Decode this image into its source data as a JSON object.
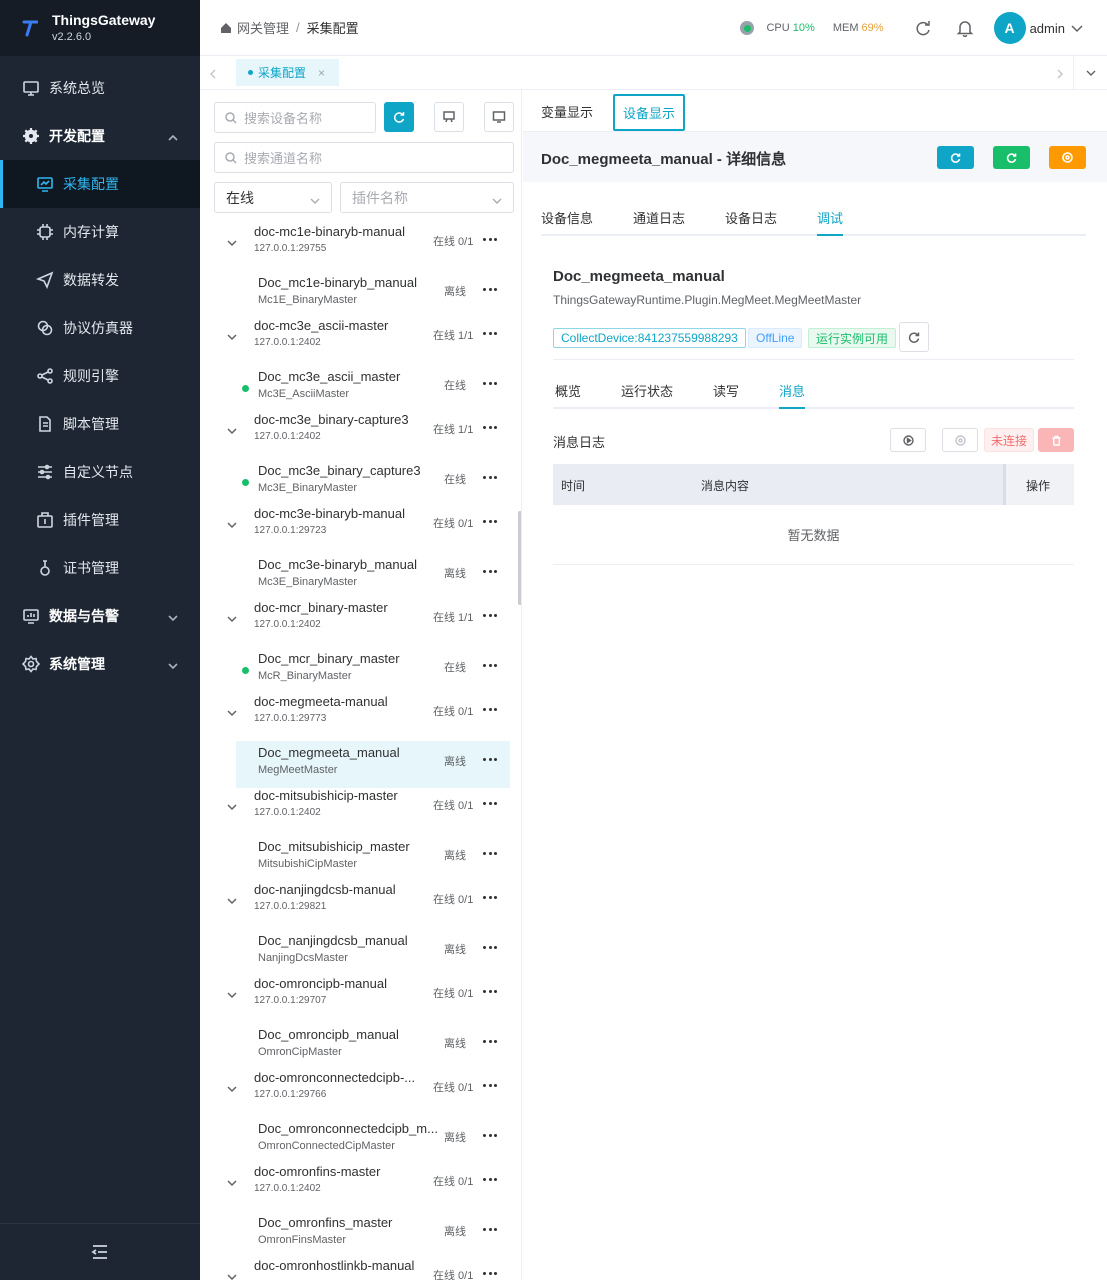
{
  "brand": {
    "name": "ThingsGateway",
    "version": "v2.2.6.0"
  },
  "sidebar": {
    "items": [
      {
        "label": "系统总览",
        "icon": "monitor-icon"
      },
      {
        "label": "开发配置",
        "icon": "gear-icon"
      },
      {
        "label": "采集配置",
        "icon": "chart-monitor-icon"
      },
      {
        "label": "内存计算",
        "icon": "chip-icon"
      },
      {
        "label": "数据转发",
        "icon": "send-icon"
      },
      {
        "label": "协议仿真器",
        "icon": "link-icon"
      },
      {
        "label": "规则引擎",
        "icon": "share-icon"
      },
      {
        "label": "脚本管理",
        "icon": "file-icon"
      },
      {
        "label": "自定义节点",
        "icon": "sliders-icon"
      },
      {
        "label": "插件管理",
        "icon": "package-icon"
      },
      {
        "label": "证书管理",
        "icon": "certificate-icon"
      },
      {
        "label": "数据与告警",
        "icon": "chart-icon"
      },
      {
        "label": "系统管理",
        "icon": "settings-icon"
      }
    ]
  },
  "header": {
    "breadcrumb_parent": "网关管理",
    "breadcrumb_sep": "/",
    "breadcrumb_current": "采集配置",
    "cpu_label": "CPU",
    "cpu_value": "10%",
    "mem_label": "MEM",
    "mem_value": "69%",
    "avatar_letter": "A",
    "username": "admin"
  },
  "page_tab": {
    "label": "采集配置",
    "close": "×"
  },
  "tree": {
    "device_search_placeholder": "搜索设备名称",
    "channel_search_placeholder": "搜索通道名称",
    "status_filter": "在线",
    "plugin_filter_placeholder": "插件名称",
    "channels": [
      {
        "name": "doc-mc1e-binaryb-manual",
        "address": "127.0.0.1:29755",
        "status": "在线 0/1",
        "device": {
          "name": "Doc_mc1e-binaryb_manual",
          "plugin": "Mc1E_BinaryMaster",
          "status": "离线",
          "online": false
        }
      },
      {
        "name": "doc-mc3e_ascii-master",
        "address": "127.0.0.1:2402",
        "status": "在线 1/1",
        "device": {
          "name": "Doc_mc3e_ascii_master",
          "plugin": "Mc3E_AsciiMaster",
          "status": "在线",
          "online": true
        }
      },
      {
        "name": "doc-mc3e_binary-capture3",
        "address": "127.0.0.1:2402",
        "status": "在线 1/1",
        "device": {
          "name": "Doc_mc3e_binary_capture3",
          "plugin": "Mc3E_BinaryMaster",
          "status": "在线",
          "online": true
        }
      },
      {
        "name": "doc-mc3e-binaryb-manual",
        "address": "127.0.0.1:29723",
        "status": "在线 0/1",
        "device": {
          "name": "Doc_mc3e-binaryb_manual",
          "plugin": "Mc3E_BinaryMaster",
          "status": "离线",
          "online": false
        }
      },
      {
        "name": "doc-mcr_binary-master",
        "address": "127.0.0.1:2402",
        "status": "在线 1/1",
        "device": {
          "name": "Doc_mcr_binary_master",
          "plugin": "McR_BinaryMaster",
          "status": "在线",
          "online": true
        }
      },
      {
        "name": "doc-megmeeta-manual",
        "address": "127.0.0.1:29773",
        "status": "在线 0/1",
        "device": {
          "name": "Doc_megmeeta_manual",
          "plugin": "MegMeetMaster",
          "status": "离线",
          "online": false,
          "selected": true
        }
      },
      {
        "name": "doc-mitsubishicip-master",
        "address": "127.0.0.1:2402",
        "status": "在线 0/1",
        "device": {
          "name": "Doc_mitsubishicip_master",
          "plugin": "MitsubishiCipMaster",
          "status": "离线",
          "online": false
        }
      },
      {
        "name": "doc-nanjingdcsb-manual",
        "address": "127.0.0.1:29821",
        "status": "在线 0/1",
        "device": {
          "name": "Doc_nanjingdcsb_manual",
          "plugin": "NanjingDcsMaster",
          "status": "离线",
          "online": false
        }
      },
      {
        "name": "doc-omroncipb-manual",
        "address": "127.0.0.1:29707",
        "status": "在线 0/1",
        "device": {
          "name": "Doc_omroncipb_manual",
          "plugin": "OmronCipMaster",
          "status": "离线",
          "online": false
        }
      },
      {
        "name": "doc-omronconnectedcipb-...",
        "address": "127.0.0.1:29766",
        "status": "在线 0/1",
        "device": {
          "name": "Doc_omronconnectedcipb_m...",
          "plugin": "OmronConnectedCipMaster",
          "status": "离线",
          "online": false
        }
      },
      {
        "name": "doc-omronfins-master",
        "address": "127.0.0.1:2402",
        "status": "在线 0/1",
        "device": {
          "name": "Doc_omronfins_master",
          "plugin": "OmronFinsMaster",
          "status": "离线",
          "online": false
        }
      },
      {
        "name": "doc-omronhostlinkb-manual",
        "address": "",
        "status": "在线 0/1",
        "device": null
      }
    ]
  },
  "detail": {
    "view_tabs": [
      "变量显示",
      "设备显示"
    ],
    "title": "Doc_megmeeta_manual - 详细信息",
    "tabs": [
      "设备信息",
      "通道日志",
      "设备日志",
      "调试"
    ],
    "device_name": "Doc_megmeeta_manual",
    "device_class": "ThingsGatewayRuntime.Plugin.MegMeet.MegMeetMaster",
    "tag_collect": "CollectDevice:841237559988293",
    "tag_offline": "OffLine",
    "tag_runtime": "运行实例可用",
    "inner_tabs": [
      "概览",
      "运行状态",
      "读写",
      "消息"
    ],
    "message_log_label": "消息日志",
    "disconnected": "未连接",
    "table_headers": [
      "时间",
      "消息内容",
      "操作"
    ],
    "empty_text": "暂无数据"
  },
  "colors": {
    "accent": "#0ea5c6",
    "online": "#19be6b",
    "sidebar_bg": "#1d2632",
    "btn_green": "#19be6b",
    "btn_orange": "#ff9900"
  }
}
